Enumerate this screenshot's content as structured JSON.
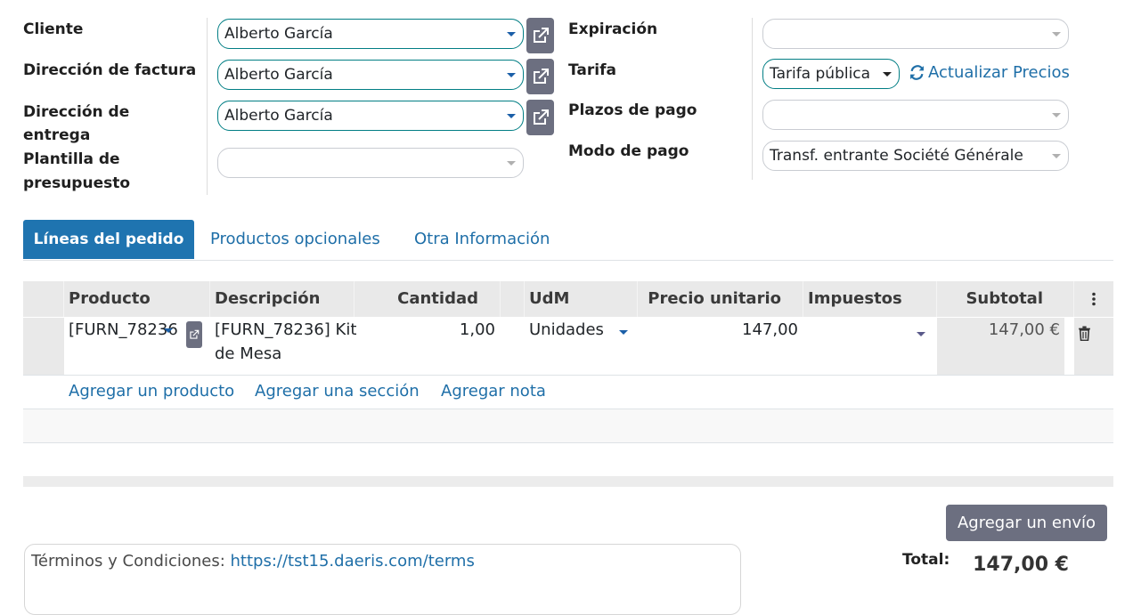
{
  "form": {
    "left": {
      "cliente_label": "Cliente",
      "cliente_value": "Alberto García",
      "dir_factura_label": "Dirección de factura",
      "dir_factura_value": "Alberto García",
      "dir_entrega_label_1": "Dirección de",
      "dir_entrega_label_2": "entrega",
      "dir_entrega_value": "Alberto García",
      "plantilla_label_1": "Plantilla de",
      "plantilla_label_2": "presupuesto",
      "plantilla_value": ""
    },
    "right": {
      "expiracion_label": "Expiración",
      "expiracion_value": "",
      "tarifa_label": "Tarifa",
      "tarifa_value": "Tarifa pública",
      "actualizar_label": "Actualizar Precios",
      "plazos_label": "Plazos de pago",
      "plazos_value": "",
      "modo_label": "Modo de pago",
      "modo_value": "Transf. entrante Société Générale"
    }
  },
  "tabs": [
    {
      "label": "Líneas del pedido",
      "active": true
    },
    {
      "label": "Productos opcionales",
      "active": false
    },
    {
      "label": "Otra Información",
      "active": false
    }
  ],
  "table": {
    "headers": {
      "producto": "Producto",
      "descripcion": "Descripción",
      "cantidad": "Cantidad",
      "udm": "UdM",
      "precio": "Precio unitario",
      "impuestos": "Impuestos",
      "subtotal": "Subtotal"
    },
    "rows": [
      {
        "producto": "[FURN_78236]",
        "descripcion_1": "[FURN_78236] Kit",
        "descripcion_2": "de Mesa",
        "cantidad": "1,00",
        "udm": "Unidades",
        "precio": "147,00",
        "impuestos": "",
        "subtotal": "147,00 €"
      }
    ],
    "add_links": {
      "producto": "Agregar un producto",
      "seccion": "Agregar una sección",
      "nota": "Agregar nota"
    }
  },
  "footer": {
    "ship_button": "Agregar un envío",
    "terms_prefix": "Términos y Condiciones:",
    "terms_link": "https://tst15.daeris.com/terms",
    "total_label": "Total:",
    "total_value": "147,00 €"
  },
  "icons": [
    "external-link-icon",
    "refresh-icon",
    "trash-icon",
    "kebab-menu-icon",
    "caret-down-icon"
  ],
  "colors": {
    "accent": "#1f74b0",
    "link": "#1f6fa8",
    "button_gray": "#6c6f80",
    "active_border": "#017e84"
  }
}
